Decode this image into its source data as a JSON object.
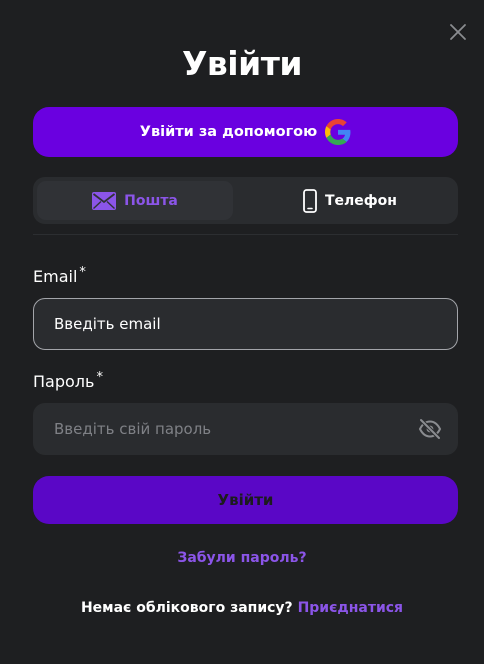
{
  "modal": {
    "title": "Увійти",
    "google_button_label": "Увійти за допомогою",
    "tabs": [
      {
        "label": "Пошта",
        "icon": "mail-icon",
        "active": true
      },
      {
        "label": "Телефон",
        "icon": "phone-icon",
        "active": false
      }
    ],
    "email": {
      "label": "Email",
      "required_mark": "*",
      "placeholder": "Введіть email",
      "value": ""
    },
    "password": {
      "label": "Пароль",
      "required_mark": "*",
      "placeholder": "Введіть свій пароль",
      "value": "",
      "toggle_icon": "eye-off-icon"
    },
    "submit_label": "Увійти",
    "forgot_label": "Забули пароль?",
    "no_account_text": "Немає облікового запису?",
    "signup_label": "Приєднатися"
  },
  "colors": {
    "background": "#1e1f21",
    "accent": "#6a00e0",
    "submit": "#5a07c6",
    "link": "#8b55e8",
    "field": "#2a2c2f"
  }
}
